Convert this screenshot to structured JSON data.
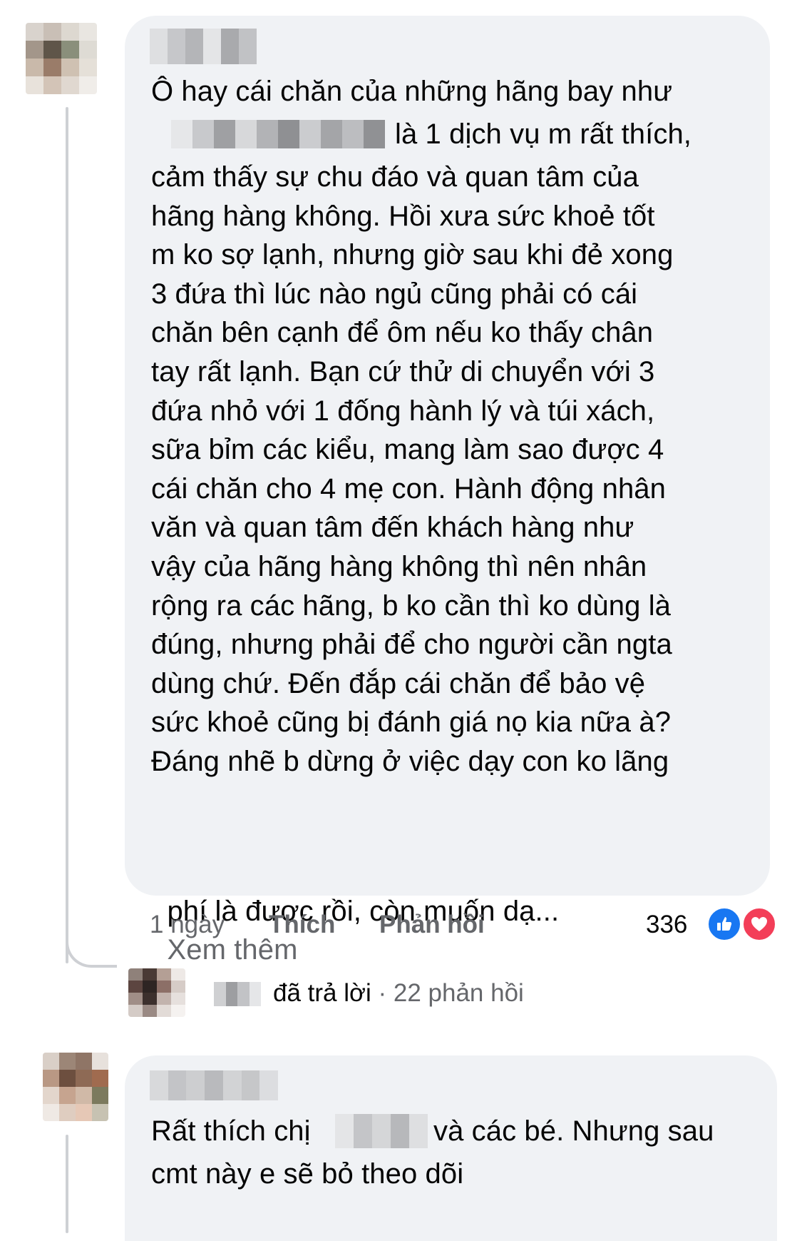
{
  "comment1": {
    "text_line1": "Ô hay cái chăn của những hãng bay như",
    "text_line2_after_redaction": "là 1 dịch vụ m rất thích,",
    "text_rest": "cảm thấy sự chu đáo và quan tâm của\nhãng hàng không. Hồi xưa sức khoẻ tốt\nm ko sợ lạnh, nhưng giờ sau khi đẻ xong\n3 đứa thì lúc nào ngủ cũng phải có cái\nchăn bên cạnh để ôm nếu ko thấy chân\ntay rất lạnh. Bạn cứ thử di chuyển với 3\nđứa nhỏ với 1 đống hành lý và túi xách,\nsữa bỉm các kiểu, mang làm sao được 4\ncái chăn cho 4 mẹ con. Hành động nhân\nvăn và quan tâm đến khách hàng như\nvậy của hãng hàng không thì nên nhân\nrộng ra các hãng, b ko cần thì ko dùng là\nđúng, nhưng phải để cho người cần ngta\ndùng chứ. Đến đắp cái chăn để bảo vệ\nsức khoẻ cũng bị đánh giá nọ kia nữa à?\nĐáng nhẽ b dừng ở việc dạy con ko lãng",
    "text_last_line": "phí là được rồi, còn muốn dạ...",
    "see_more": "Xem thêm",
    "time": "1 ngày",
    "like_label": "Thích",
    "reply_label": "Phản hồi",
    "reaction_count": "336",
    "reactions": [
      "like-icon",
      "love-icon"
    ],
    "colors": {
      "like": "#1877f2",
      "love": "#f33e58"
    }
  },
  "reply_summary": {
    "replied_text": "đã trả lời",
    "separator": "·",
    "replies_count": "22 phản hồi"
  },
  "comment2": {
    "text_before_redaction": "Rất thích chị",
    "text_after_redaction": "và các bé. Nhưng sau",
    "text_line2": "cmt này e sẽ bỏ theo dõi"
  },
  "colors": {
    "bubble": "#f0f2f5",
    "muted_text": "#65676b",
    "thread_line": "#ced0d4"
  }
}
